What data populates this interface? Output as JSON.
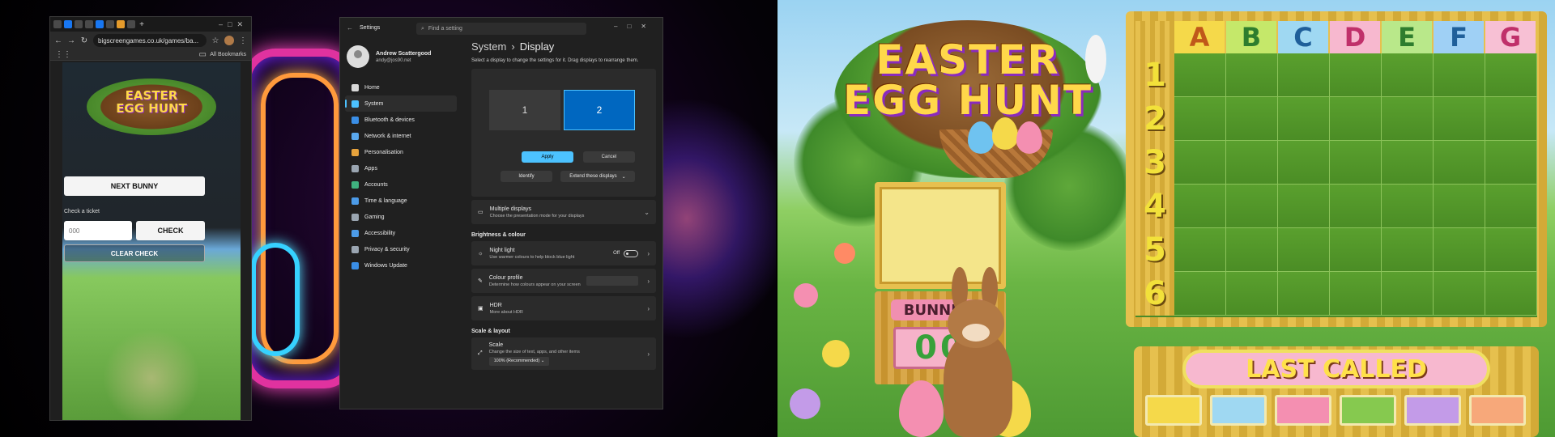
{
  "browser": {
    "url": "bigscreengames.co.uk/games/ba...",
    "bookmarks_label": "All Bookmarks",
    "page": {
      "logo_line1": "EASTER",
      "logo_line2": "EGG HUNT",
      "next_bunny_label": "NEXT BUNNY",
      "check_ticket_label": "Check a ticket",
      "ticket_placeholder": "000",
      "check_label": "CHECK",
      "clear_check_label": "CLEAR CHECK"
    }
  },
  "settings": {
    "window_title": "Settings",
    "search_placeholder": "Find a setting",
    "user": {
      "name": "Andrew Scattergood",
      "email": "andy@jos90.net"
    },
    "nav": [
      {
        "label": "Home",
        "icon": "home-icon",
        "color": "#d9d9d9"
      },
      {
        "label": "System",
        "icon": "system-icon",
        "color": "#4cc2ff",
        "active": true
      },
      {
        "label": "Bluetooth & devices",
        "icon": "bluetooth-icon",
        "color": "#3a8ee6"
      },
      {
        "label": "Network & internet",
        "icon": "network-icon",
        "color": "#5aa9f0"
      },
      {
        "label": "Personalisation",
        "icon": "brush-icon",
        "color": "#e6a23c"
      },
      {
        "label": "Apps",
        "icon": "apps-icon",
        "color": "#9aa5b1"
      },
      {
        "label": "Accounts",
        "icon": "accounts-icon",
        "color": "#3fb37f"
      },
      {
        "label": "Time & language",
        "icon": "globe-icon",
        "color": "#4c9be8"
      },
      {
        "label": "Gaming",
        "icon": "gaming-icon",
        "color": "#9aa5b1"
      },
      {
        "label": "Accessibility",
        "icon": "accessibility-icon",
        "color": "#4c9be8"
      },
      {
        "label": "Privacy & security",
        "icon": "shield-icon",
        "color": "#9aa5b1"
      },
      {
        "label": "Windows Update",
        "icon": "update-icon",
        "color": "#3a8ee6"
      }
    ],
    "breadcrumb_parent": "System",
    "breadcrumb_sep": "›",
    "breadcrumb_current": "Display",
    "description": "Select a display to change the settings for it. Drag displays to rearrange them.",
    "monitors": [
      "1",
      "2"
    ],
    "apply_label": "Apply",
    "cancel_label": "Cancel",
    "identify_label": "Identify",
    "extend_label": "Extend these displays",
    "multiple_displays": {
      "title": "Multiple displays",
      "subtitle": "Choose the presentation mode for your displays"
    },
    "section_brightness": "Brightness & colour",
    "night_light": {
      "title": "Night light",
      "subtitle": "Use warmer colours to help block blue light",
      "state": "Off"
    },
    "colour_profile": {
      "title": "Colour profile",
      "subtitle": "Determine how colours appear on your screen"
    },
    "hdr": {
      "title": "HDR",
      "link": "More about HDR"
    },
    "section_scale": "Scale & layout",
    "scale": {
      "title": "Scale",
      "subtitle": "Change the size of text, apps, and other items",
      "value": "100% (Recommended)"
    }
  },
  "game": {
    "logo_line1": "EASTER",
    "logo_line2": "EGG HUNT",
    "columns": [
      {
        "label": "A",
        "color": "#f5d94a",
        "text": "#c0581a"
      },
      {
        "label": "B",
        "color": "#c5e86a",
        "text": "#2e7d2e"
      },
      {
        "label": "C",
        "color": "#9fd8f2",
        "text": "#1f5f9a"
      },
      {
        "label": "D",
        "color": "#f7b8cf",
        "text": "#c0306a"
      },
      {
        "label": "E",
        "color": "#b9e88a",
        "text": "#2e7d2e"
      },
      {
        "label": "F",
        "color": "#9fd0f5",
        "text": "#1f5f9a"
      },
      {
        "label": "G",
        "color": "#f7c0d4",
        "text": "#c0306a"
      }
    ],
    "rows": [
      "1",
      "2",
      "3",
      "4",
      "5",
      "6"
    ],
    "bunnies_label": "BUNNIES",
    "bunnies_count": "00",
    "last_called_label": "LAST CALLED",
    "last_called_slots": [
      "#f5d94a",
      "#9fd8f2",
      "#f48fb1",
      "#86c94f",
      "#c39be8",
      "#f7a87a"
    ]
  }
}
